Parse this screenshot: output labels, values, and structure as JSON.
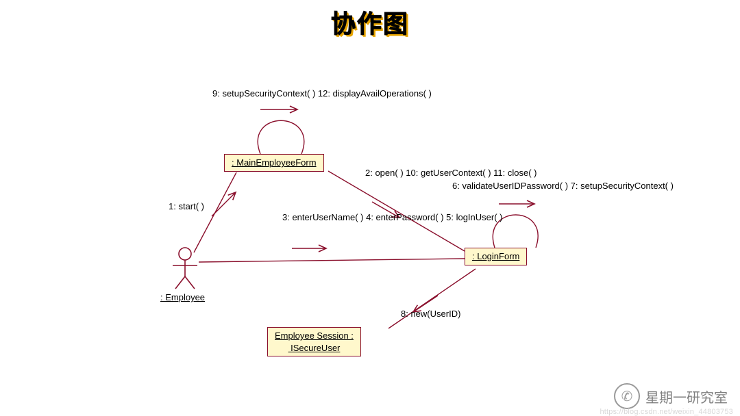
{
  "title": "协作图",
  "actor": {
    "label": ": Employee"
  },
  "objects": {
    "mainForm": ": MainEmployeeForm",
    "loginForm": ": LoginForm",
    "session": "Employee Session :\n ISecureUser"
  },
  "messages": {
    "start": "1: start( )",
    "selfMain": "9: setupSecurityContext( )\n12: displayAvailOperations( )",
    "mainToLogin": "2: open( )\n10: getUserContext( )\n11: close( )",
    "selfLogin": "6: validateUserIDPassword( )\n7: setupSecurityContext( )",
    "actorToLogin": "3: enterUserName( )\n4: enterPassword( )\n5: logInUser( )",
    "newSession": "8: new(UserID)"
  },
  "watermark": {
    "brand": "星期一研究室",
    "url": "https://blog.csdn.net/weixin_44803753"
  },
  "colors": {
    "line": "#8a0f2c",
    "box": "#fff8cc"
  }
}
